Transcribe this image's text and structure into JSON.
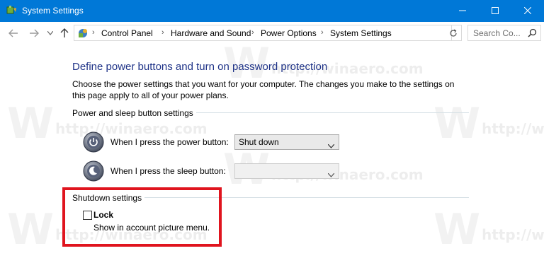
{
  "window": {
    "title": "System Settings",
    "accent_color": "#0078d7",
    "controls": {
      "minimize_icon": "minimize-icon",
      "maximize_icon": "maximize-icon",
      "close_icon": "close-icon"
    }
  },
  "nav": {
    "breadcrumbs": [
      "Control Panel",
      "Hardware and Sound",
      "Power Options",
      "System Settings"
    ],
    "search_placeholder": "Search Co..."
  },
  "page": {
    "heading": "Define power buttons and turn on password protection",
    "description": "Choose the power settings that you want for your computer. The changes you make to the settings on this page apply to all of your power plans.",
    "heading_color": "#1e3287"
  },
  "power_sleep": {
    "group_label": "Power and sleep button settings",
    "power_button_label": "When I press the power button:",
    "power_button_value": "Shut down",
    "sleep_button_label": "When I press the sleep button:",
    "sleep_button_value": ""
  },
  "shutdown": {
    "group_label": "Shutdown settings",
    "lock_label": "Lock",
    "lock_checked": false,
    "lock_description": "Show in account picture menu.",
    "highlight_color": "#e0141e"
  },
  "watermark": {
    "letter": "W",
    "url": "http://winaero.com"
  }
}
